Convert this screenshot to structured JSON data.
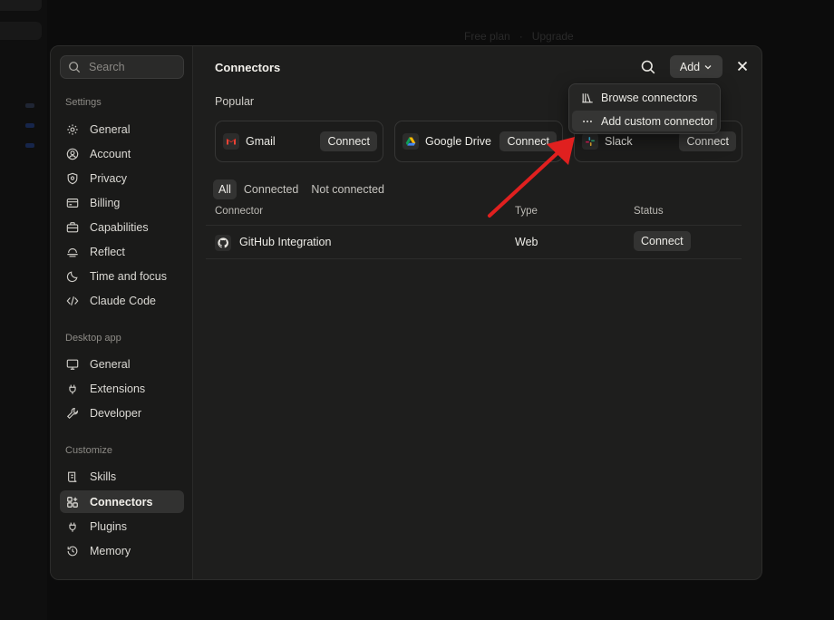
{
  "background": {
    "header_items": [
      "Free plan",
      "·",
      "Upgrade"
    ]
  },
  "sidebar": {
    "search_placeholder": "Search",
    "sections": [
      {
        "label": "Settings",
        "items": [
          {
            "label": "General",
            "icon": "gear-icon"
          },
          {
            "label": "Account",
            "icon": "user-circle-icon"
          },
          {
            "label": "Privacy",
            "icon": "shield-icon"
          },
          {
            "label": "Billing",
            "icon": "credit-card-icon"
          },
          {
            "label": "Capabilities",
            "icon": "briefcase-icon"
          },
          {
            "label": "Reflect",
            "icon": "reflect-icon"
          },
          {
            "label": "Time and focus",
            "icon": "moon-icon"
          },
          {
            "label": "Claude Code",
            "icon": "code-icon"
          }
        ]
      },
      {
        "label": "Desktop app",
        "items": [
          {
            "label": "General",
            "icon": "monitor-icon"
          },
          {
            "label": "Extensions",
            "icon": "plug-icon"
          },
          {
            "label": "Developer",
            "icon": "wrench-icon"
          }
        ]
      },
      {
        "label": "Customize",
        "items": [
          {
            "label": "Skills",
            "icon": "scroll-icon"
          },
          {
            "label": "Connectors",
            "icon": "connectors-icon",
            "active": true
          },
          {
            "label": "Plugins",
            "icon": "plug-icon"
          },
          {
            "label": "Memory",
            "icon": "history-icon"
          }
        ]
      }
    ]
  },
  "main": {
    "title": "Connectors",
    "add_label": "Add",
    "popular_label": "Popular",
    "popular": [
      {
        "name": "Gmail",
        "action": "Connect",
        "icon": "gmail-icon"
      },
      {
        "name": "Google Drive",
        "action": "Connect",
        "icon": "google-drive-icon"
      },
      {
        "name": "Slack",
        "action": "Connect",
        "icon": "slack-icon"
      }
    ],
    "filters": [
      "All",
      "Connected",
      "Not connected"
    ],
    "active_filter": "All",
    "table": {
      "headers": [
        "Connector",
        "Type",
        "Status"
      ],
      "rows": [
        {
          "name": "GitHub Integration",
          "type": "Web",
          "status_action": "Connect",
          "icon": "github-icon"
        }
      ]
    }
  },
  "dropdown": {
    "items": [
      {
        "label": "Browse connectors",
        "icon": "library-icon"
      },
      {
        "label": "Add custom connector",
        "icon": "more-horizontal-icon",
        "highlighted": true
      }
    ]
  },
  "colors": {
    "modal_bg": "#1e1e1d",
    "sidebar_bg": "#1a1a19",
    "active_item_bg": "#323231",
    "button_bg": "#333332",
    "annotation_arrow": "#e0201f"
  }
}
